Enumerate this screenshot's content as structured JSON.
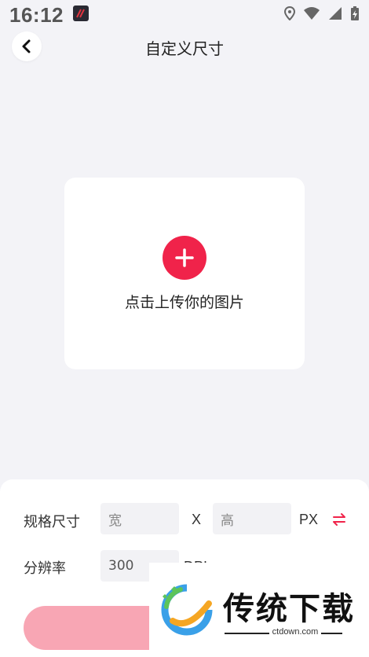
{
  "status_bar": {
    "time": "16:12",
    "icons": [
      "app-notification-icon",
      "location-icon",
      "wifi-icon",
      "signal-icon",
      "battery-charging-icon"
    ]
  },
  "header": {
    "back_icon": "chevron-left-icon",
    "title": "自定义尺寸"
  },
  "upload": {
    "icon": "plus-icon",
    "label": "点击上传你的图片"
  },
  "form": {
    "size_label": "规格尺寸",
    "width_placeholder": "宽",
    "separator": "X",
    "height_placeholder": "高",
    "size_unit": "PX",
    "swap_icon": "swap-icon",
    "resolution_label": "分辨率",
    "resolution_value": "300",
    "resolution_unit": "DPI"
  },
  "watermark": {
    "title": "传统下载",
    "subtitle": "ctdown.com"
  },
  "colors": {
    "accent": "#f0234a",
    "button_disabled": "#f8a6b4",
    "background": "#f3f3f7"
  }
}
